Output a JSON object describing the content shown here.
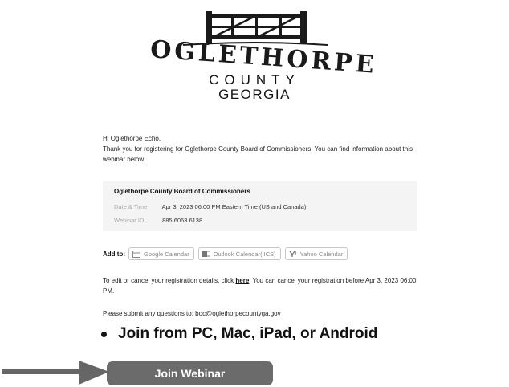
{
  "logo": {
    "word": "OGLETHORPE",
    "county": "COUNTY",
    "state": "GEORGIA"
  },
  "email": {
    "greeting": "Hi Oglethorpe Echo,",
    "intro": "Thank you for registering for Oglethorpe County Board of Commissioners. You can find information about this webinar below.",
    "card": {
      "title": "Oglethorpe County Board of Commissioners",
      "date_label": "Date & Time",
      "date_value": "Apr 3, 2023 06:00 PM Eastern Time (US and Canada)",
      "id_label": "Webinar ID",
      "id_value": "885 6063 6138"
    },
    "add_to": {
      "label": "Add to:",
      "google": "Google Calendar",
      "outlook": "Outlook Calendar(.ICS)",
      "yahoo": "Yahoo Calendar"
    },
    "edit": {
      "before_link": "To edit or cancel your registration details, click ",
      "link": "here",
      "after_link": ". You can cancel your registration before Apr 3, 2023 06:00 PM."
    },
    "questions": "Please submit any questions to: boc@oglethorpecountyga.gov"
  },
  "join": {
    "bullet_text": "Join from PC, Mac, iPad, or Android",
    "button_label": "Join Webinar"
  },
  "colors": {
    "button_bg": "#6b6b6b",
    "arrow": "#666666",
    "card_bg": "#f4f4f4"
  }
}
